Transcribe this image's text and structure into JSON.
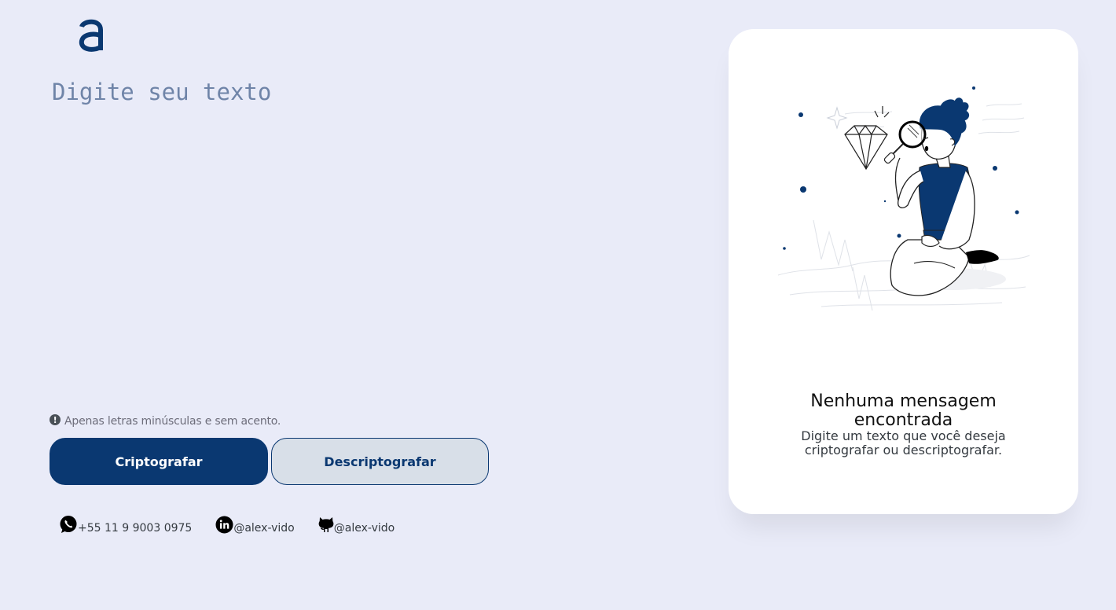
{
  "logo": {
    "icon": "alura-a-logo-icon",
    "color": "#0a3871"
  },
  "editor": {
    "placeholder": "Digite seu texto",
    "value": ""
  },
  "hint": {
    "icon": "exclamation-circle-icon",
    "text": "Apenas letras minúsculas e sem acento."
  },
  "actions": {
    "encrypt_label": "Criptografar",
    "decrypt_label": "Descriptografar"
  },
  "contacts": [
    {
      "icon": "whatsapp-icon",
      "text": "+55 11 9 9003 0975"
    },
    {
      "icon": "linkedin-icon",
      "text": "@alex-vido"
    },
    {
      "icon": "github-icon",
      "text": "@alex-vido"
    }
  ],
  "output_panel": {
    "illustration": "person-with-magnifying-glass-illustration",
    "title": "Nenhuma mensagem encontrada",
    "subtitle": "Digite um texto que você deseja criptografar ou descriptografar."
  },
  "colors": {
    "background": "#e9ebf8",
    "primary": "#0a3871",
    "secondary_button": "#d8dfe8",
    "panel": "#ffffff"
  }
}
